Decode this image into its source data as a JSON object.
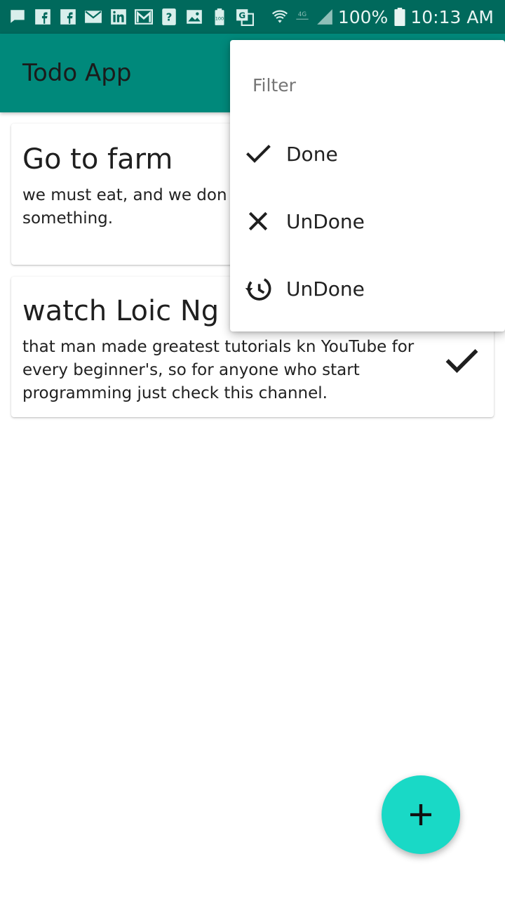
{
  "status_bar": {
    "left_icons": [
      "chat-bubble-icon",
      "facebook-icon",
      "facebook-icon",
      "email-icon",
      "linkedin-icon",
      "gmail-icon",
      "help-icon",
      "image-icon",
      "battery-100-icon",
      "translate-icon"
    ],
    "battery_percent": "100%",
    "time": "10:13 AM",
    "background": "#00695c"
  },
  "app_bar": {
    "title": "Todo App",
    "background": "#00897b"
  },
  "todos": [
    {
      "title": "Go to farm",
      "description": "we must eat, and we don money, so we need to go something.",
      "done": false
    },
    {
      "title": "watch Loic Ng",
      "description": "that man made greatest tutorials kn YouTube for every beginner's, so for anyone who start programming just check this channel.",
      "done": true
    }
  ],
  "filter_menu": {
    "header": "Filter",
    "items": [
      {
        "label": "Done",
        "icon": "check-icon"
      },
      {
        "label": "UnDone",
        "icon": "close-icon"
      },
      {
        "label": "UnDone",
        "icon": "history-icon"
      }
    ]
  },
  "fab": {
    "icon": "plus-icon",
    "color": "#19d9c6"
  }
}
